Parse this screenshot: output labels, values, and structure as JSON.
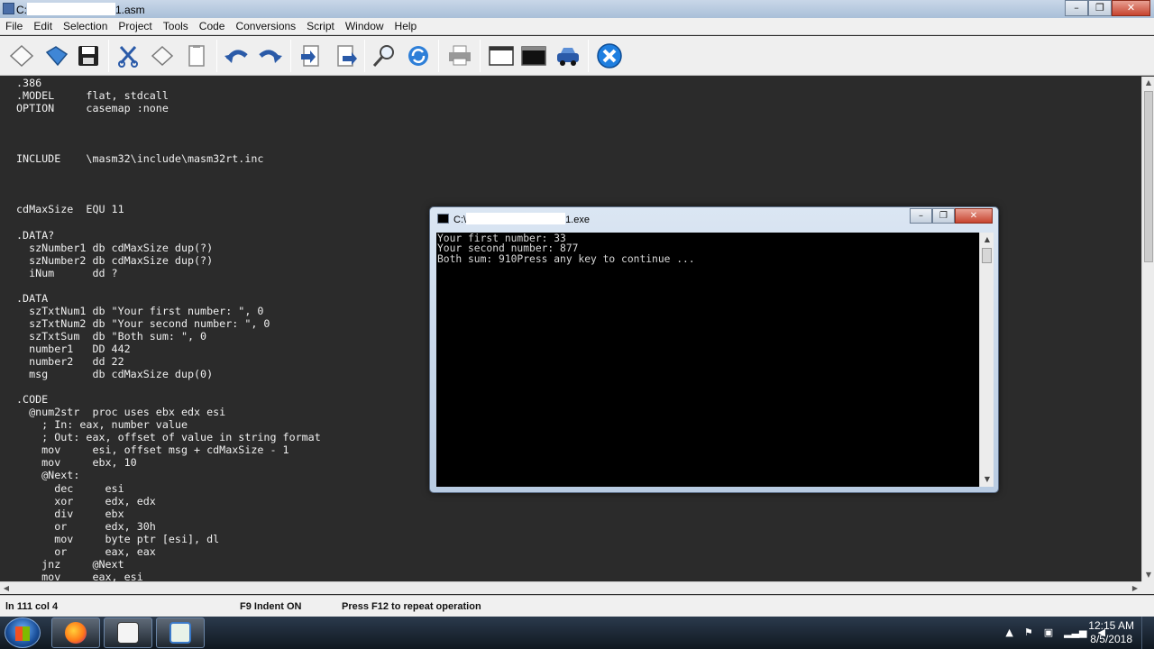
{
  "window": {
    "title_prefix": "C:",
    "title_suffix": "1.asm",
    "minimize": "–",
    "maximize": "❐",
    "close": "✕"
  },
  "menu": [
    "File",
    "Edit",
    "Selection",
    "Project",
    "Tools",
    "Code",
    "Conversions",
    "Script",
    "Window",
    "Help"
  ],
  "toolbar_icons": [
    "new-file-icon",
    "open-file-icon",
    "save-icon",
    "cut-icon",
    "copy-icon",
    "paste-icon",
    "undo-icon",
    "redo-icon",
    "import-icon",
    "export-icon",
    "find-icon",
    "replace-icon",
    "print-icon",
    "window-icon",
    "console-icon",
    "car-icon",
    "close-circle-icon"
  ],
  "code_lines": [
    ".386",
    ".MODEL     flat, stdcall",
    "OPTION     casemap :none",
    "",
    "",
    "",
    "INCLUDE    \\masm32\\include\\masm32rt.inc",
    "",
    "",
    "",
    "cdMaxSize  EQU 11",
    "",
    ".DATA?",
    "  szNumber1 db cdMaxSize dup(?)",
    "  szNumber2 db cdMaxSize dup(?)",
    "  iNum      dd ?",
    "",
    ".DATA",
    "  szTxtNum1 db \"Your first number: \", 0",
    "  szTxtNum2 db \"Your second number: \", 0",
    "  szTxtSum  db \"Both sum: \", 0",
    "  number1   DD 442",
    "  number2   dd 22",
    "  msg       db cdMaxSize dup(0)",
    "",
    ".CODE",
    "  @num2str  proc uses ebx edx esi",
    "    ; In: eax, number value",
    "    ; Out: eax, offset of value in string format",
    "    mov     esi, offset msg + cdMaxSize - 1",
    "    mov     ebx, 10",
    "    @Next:",
    "      dec     esi",
    "      xor     edx, edx",
    "      div     ebx",
    "      or      edx, 30h",
    "      mov     byte ptr [esi], dl",
    "      or      eax, eax",
    "    jnz     @Next",
    "    mov     eax, esi"
  ],
  "status": {
    "position": "ln 111 col 4",
    "indent": "F9 Indent ON",
    "hint": "Press F12 to repeat operation"
  },
  "console": {
    "title_prefix": "C:\\",
    "title_suffix": "1.exe",
    "minimize": "–",
    "maximize": "❐",
    "close": "✕",
    "output": "Your first number: 33\nYour second number: 877\nBoth sum: 910Press any key to continue ..."
  },
  "taskbar": {
    "apps": [
      "firefox-icon",
      "qeditor-icon",
      "console-app-icon"
    ],
    "time": "12:15 AM",
    "date": "8/5/2018",
    "tray_arrow": "▲"
  }
}
